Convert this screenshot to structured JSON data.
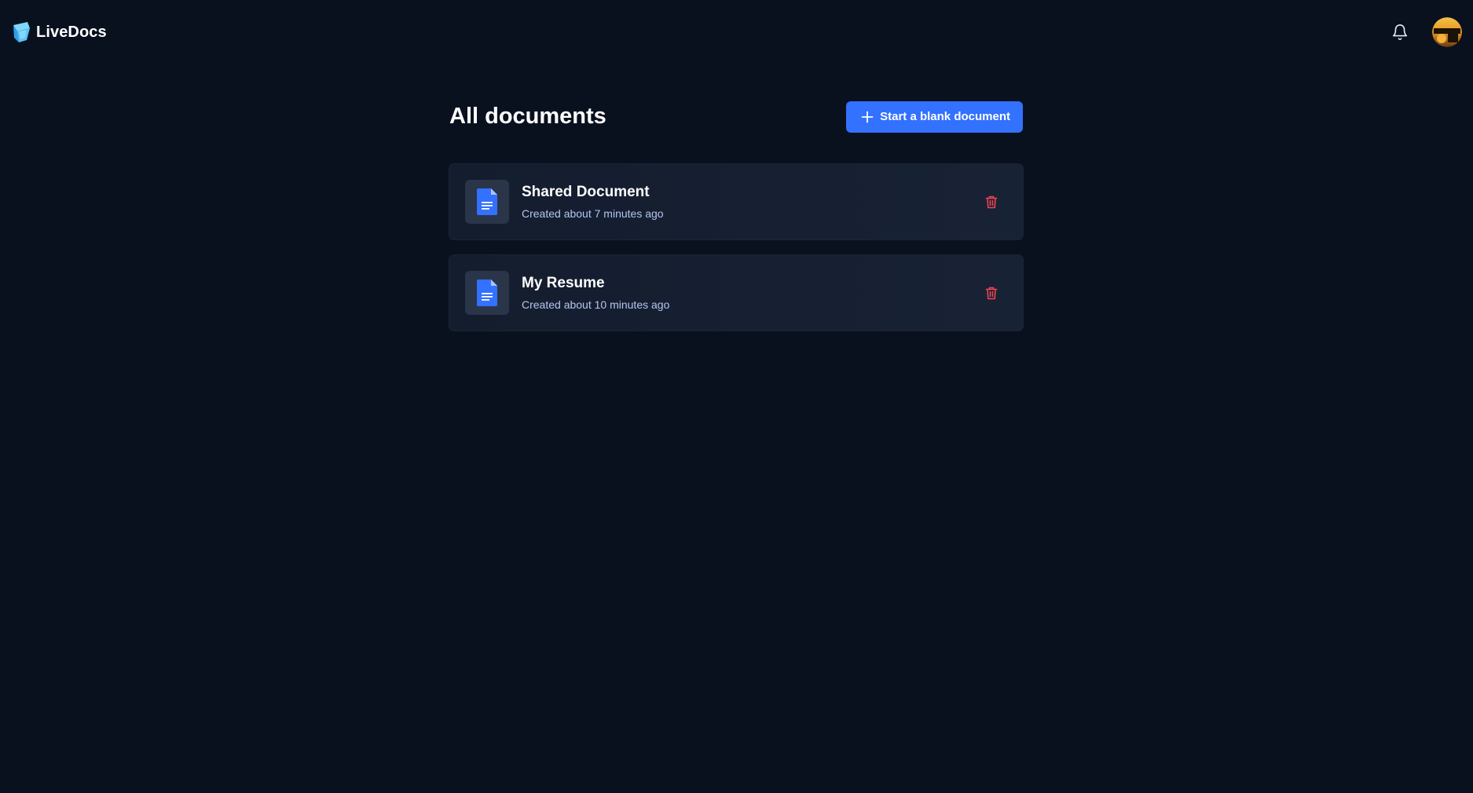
{
  "brand": {
    "name": "LiveDocs",
    "logo_icon": "livedocs-logo-icon"
  },
  "header": {
    "notification_icon": "bell-icon",
    "avatar_icon": "avatar-icon"
  },
  "main": {
    "title": "All documents",
    "new_button": {
      "label": "Start a blank document",
      "icon": "plus-icon"
    }
  },
  "documents": [
    {
      "title": "Shared Document",
      "created": "Created about 7 minutes ago",
      "icon": "document-icon",
      "action_icon": "trash-icon"
    },
    {
      "title": "My Resume",
      "created": "Created about 10 minutes ago",
      "icon": "document-icon",
      "action_icon": "trash-icon"
    }
  ],
  "colors": {
    "background": "#09111f",
    "accent": "#3371ff",
    "card": "#161f31",
    "danger": "#f04452",
    "muted_text": "#b4c6ee"
  }
}
